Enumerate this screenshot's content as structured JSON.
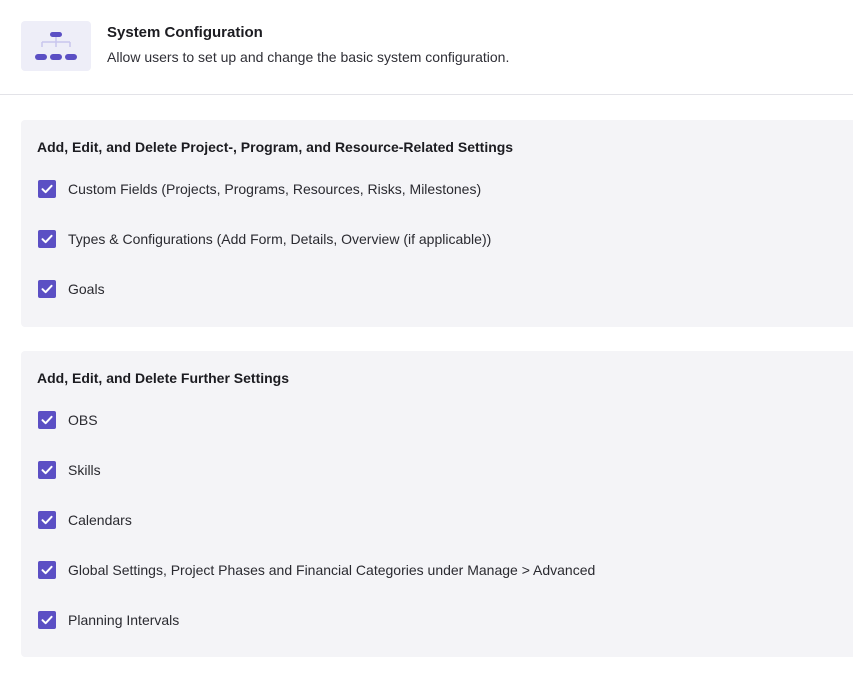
{
  "header": {
    "title": "System Configuration",
    "description": "Allow users to set up and change the basic system configuration.",
    "icon": "org-structure-icon"
  },
  "sections": [
    {
      "title": "Add, Edit, and Delete Project-, Program, and Resource-Related Settings",
      "items": [
        {
          "label": "Custom Fields (Projects, Programs, Resources, Risks, Milestones)",
          "checked": true
        },
        {
          "label": "Types & Configurations (Add Form, Details, Overview (if applicable))",
          "checked": true
        },
        {
          "label": "Goals",
          "checked": true
        }
      ]
    },
    {
      "title": "Add, Edit, and Delete Further Settings",
      "items": [
        {
          "label": "OBS",
          "checked": true
        },
        {
          "label": "Skills",
          "checked": true
        },
        {
          "label": "Calendars",
          "checked": true
        },
        {
          "label": "Global Settings, Project Phases and Financial Categories under Manage > Advanced",
          "checked": true
        },
        {
          "label": "Planning Intervals",
          "checked": true
        }
      ]
    }
  ],
  "colors": {
    "accent": "#5b4fc4",
    "section_bg": "#f4f4f7",
    "icon_bg": "#eeeef8"
  }
}
